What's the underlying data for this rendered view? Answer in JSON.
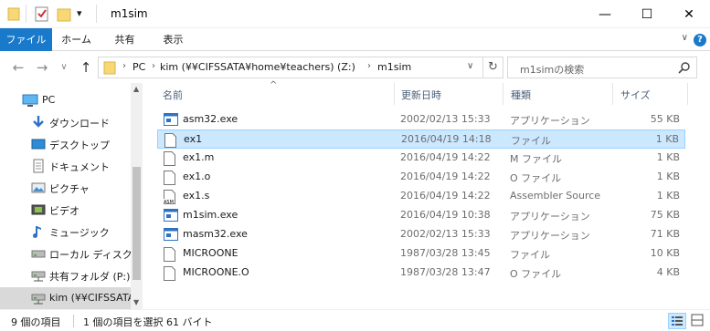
{
  "window": {
    "title": "m1sim",
    "minimize": "—",
    "maximize": "☐",
    "close": "✕"
  },
  "quick_access": {
    "dropdown": "▾"
  },
  "ribbon": {
    "tabs": [
      "ファイル",
      "ホーム",
      "共有",
      "表示"
    ],
    "collapse": "∨",
    "help": "?"
  },
  "nav": {
    "back": "←",
    "forward": "→",
    "recent": "∨",
    "up": "↑"
  },
  "address": {
    "segments": [
      "PC",
      "kim (¥¥CIFSSATA¥home¥teachers) (Z:)",
      "m1sim"
    ],
    "dropdown": "∨",
    "refresh": "↻"
  },
  "search": {
    "placeholder": "m1simの検索",
    "icon": "search-icon"
  },
  "navpane": {
    "items": [
      {
        "label": "PC",
        "icon": "pc-icon",
        "level": 0
      },
      {
        "label": "ダウンロード",
        "icon": "download-icon",
        "level": 1
      },
      {
        "label": "デスクトップ",
        "icon": "desktop-icon",
        "level": 1
      },
      {
        "label": "ドキュメント",
        "icon": "documents-icon",
        "level": 1
      },
      {
        "label": "ピクチャ",
        "icon": "pictures-icon",
        "level": 1
      },
      {
        "label": "ビデオ",
        "icon": "videos-icon",
        "level": 1
      },
      {
        "label": "ミュージック",
        "icon": "music-icon",
        "level": 1
      },
      {
        "label": "ローカル ディスク (C",
        "icon": "drive-icon",
        "level": 1
      },
      {
        "label": "共有フォルダ (P:)",
        "icon": "network-drive-icon",
        "level": 1
      },
      {
        "label": "kim (¥¥CIFSSATA",
        "icon": "network-drive-icon",
        "level": 1,
        "selected": true
      }
    ]
  },
  "columns": {
    "name": "名前",
    "date": "更新日時",
    "type": "種類",
    "size": "サイズ",
    "sort_indicator": "^"
  },
  "files": [
    {
      "name": "asm32.exe",
      "date": "2002/02/13 15:33",
      "type": "アプリケーション",
      "size": "55 KB",
      "icon": "exe-icon"
    },
    {
      "name": "ex1",
      "date": "2016/04/19 14:18",
      "type": "ファイル",
      "size": "1 KB",
      "icon": "file-icon",
      "selected": true
    },
    {
      "name": "ex1.m",
      "date": "2016/04/19 14:22",
      "type": "M ファイル",
      "size": "1 KB",
      "icon": "file-icon"
    },
    {
      "name": "ex1.o",
      "date": "2016/04/19 14:22",
      "type": "O ファイル",
      "size": "1 KB",
      "icon": "file-icon"
    },
    {
      "name": "ex1.s",
      "date": "2016/04/19 14:22",
      "type": "Assembler Source",
      "size": "1 KB",
      "icon": "asm-file-icon"
    },
    {
      "name": "m1sim.exe",
      "date": "2016/04/19 10:38",
      "type": "アプリケーション",
      "size": "75 KB",
      "icon": "exe-icon"
    },
    {
      "name": "masm32.exe",
      "date": "2002/02/13 15:33",
      "type": "アプリケーション",
      "size": "71 KB",
      "icon": "exe-icon"
    },
    {
      "name": "MICROONE",
      "date": "1987/03/28 13:45",
      "type": "ファイル",
      "size": "10 KB",
      "icon": "file-icon"
    },
    {
      "name": "MICROONE.O",
      "date": "1987/03/28 13:47",
      "type": "O ファイル",
      "size": "4 KB",
      "icon": "file-icon"
    }
  ],
  "status": {
    "count": "9 個の項目",
    "selection": "1 個の項目を選択  61 バイト"
  },
  "colors": {
    "accent": "#1979ca",
    "selection_bg": "#cce8ff",
    "selection_border": "#99d1ff"
  }
}
